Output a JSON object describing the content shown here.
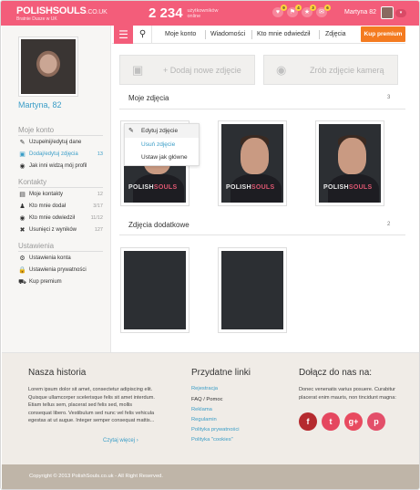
{
  "header": {
    "logo_text": "POLISHSOULS",
    "logo_domain": ".CO.UK",
    "tagline": "Bratnie Dusze w UK",
    "online_count": "2 234",
    "online_label_1": "użytkowników",
    "online_label_2": "online",
    "notifications": [
      {
        "icon": "♥",
        "count": "9"
      },
      {
        "icon": "⚑",
        "count": "4"
      },
      {
        "icon": "★",
        "count": "3"
      },
      {
        "icon": "✉",
        "count": "6"
      }
    ],
    "username": "Martyna 82",
    "dropdown_icon": "▾"
  },
  "sidebar": {
    "profile_name": "Martyna, 82",
    "sections": {
      "account": "Moje konto",
      "contacts": "Kontakty",
      "settings": "Ustawienia"
    },
    "account_items": [
      {
        "icon": "✎",
        "label": "Uzupełnij/edytuj dane",
        "count": ""
      },
      {
        "icon": "▣",
        "label": "Dodaj/edytuj zdjęcia",
        "count": "13"
      },
      {
        "icon": "◉",
        "label": "Jak inni widzą mój profil",
        "count": ""
      }
    ],
    "contact_items": [
      {
        "icon": "▤",
        "label": "Moje kontakty",
        "count": "12"
      },
      {
        "icon": "♟",
        "label": "Kto mnie dodał",
        "count": "3/17"
      },
      {
        "icon": "◉",
        "label": "Kto mnie odwiedził",
        "count": "11/12"
      },
      {
        "icon": "✖",
        "label": "Usunięci z wyników",
        "count": "127"
      }
    ],
    "settings_items": [
      {
        "icon": "⚙",
        "label": "Ustawienia konta",
        "count": ""
      },
      {
        "icon": "🔒",
        "label": "Ustawienia prywatności",
        "count": ""
      },
      {
        "icon": "⛟",
        "label": "Kup premium",
        "count": ""
      }
    ]
  },
  "nav": {
    "links": [
      "Moje konto",
      "Wiadomości",
      "Kto mnie odwiedził",
      "Zdjęcia"
    ],
    "premium": "Kup premium"
  },
  "actions": {
    "add_photo": "+ Dodaj  nowe zdjęcie",
    "camera_photo": "Zrób zdjęcie kamerą"
  },
  "my_photos": {
    "title": "Moje zdjęcia",
    "count": "3",
    "watermark_a": "POLISH",
    "watermark_b": "SOULS"
  },
  "context_menu": {
    "items": [
      "Edytuj zdjęcie",
      "Usuń zdjęcie",
      "Ustaw jak główne"
    ]
  },
  "extra_photos": {
    "title": "Zdjęcia dodatkowe",
    "count": "2"
  },
  "footer": {
    "history_title": "Nasza historia",
    "history_text": "Lorem ipsum dolor sit amet, consectetur adipiscing elit. Quisque ullamcorper scelerisque felis sit amet interdum. Etiam tellus sem, placerat sed felis sed, mollis consequat libero. Vestibulum sed nunc vel felis vehicula egestas at ut augue. Integer semper consequat mattis...",
    "read_more": "Czytaj więcej",
    "links_title": "Przydatne linki",
    "links": [
      "Rejestracja",
      "FAQ / Pomoc",
      "Reklama",
      "Regulamin",
      "Polityka prywatności",
      "Polityka \"cookies\""
    ],
    "join_title": "Dołącz do nas na:",
    "join_text": "Donec venenatis varius posuere. Curabitur placerat enim mauris, non tincidunt magna:",
    "social": [
      "f",
      "t",
      "g+",
      "p"
    ],
    "copyright": "Copyright © 2013 PolishSouls.co.uk - All Right Reserved."
  },
  "colors": {
    "brand": "#f35d7a",
    "accent": "#f47b20",
    "link": "#3a9dc7",
    "facebook": "#b52a2e",
    "twitter": "#e5475f",
    "google": "#e84a5f",
    "pinterest": "#e34f6a"
  }
}
